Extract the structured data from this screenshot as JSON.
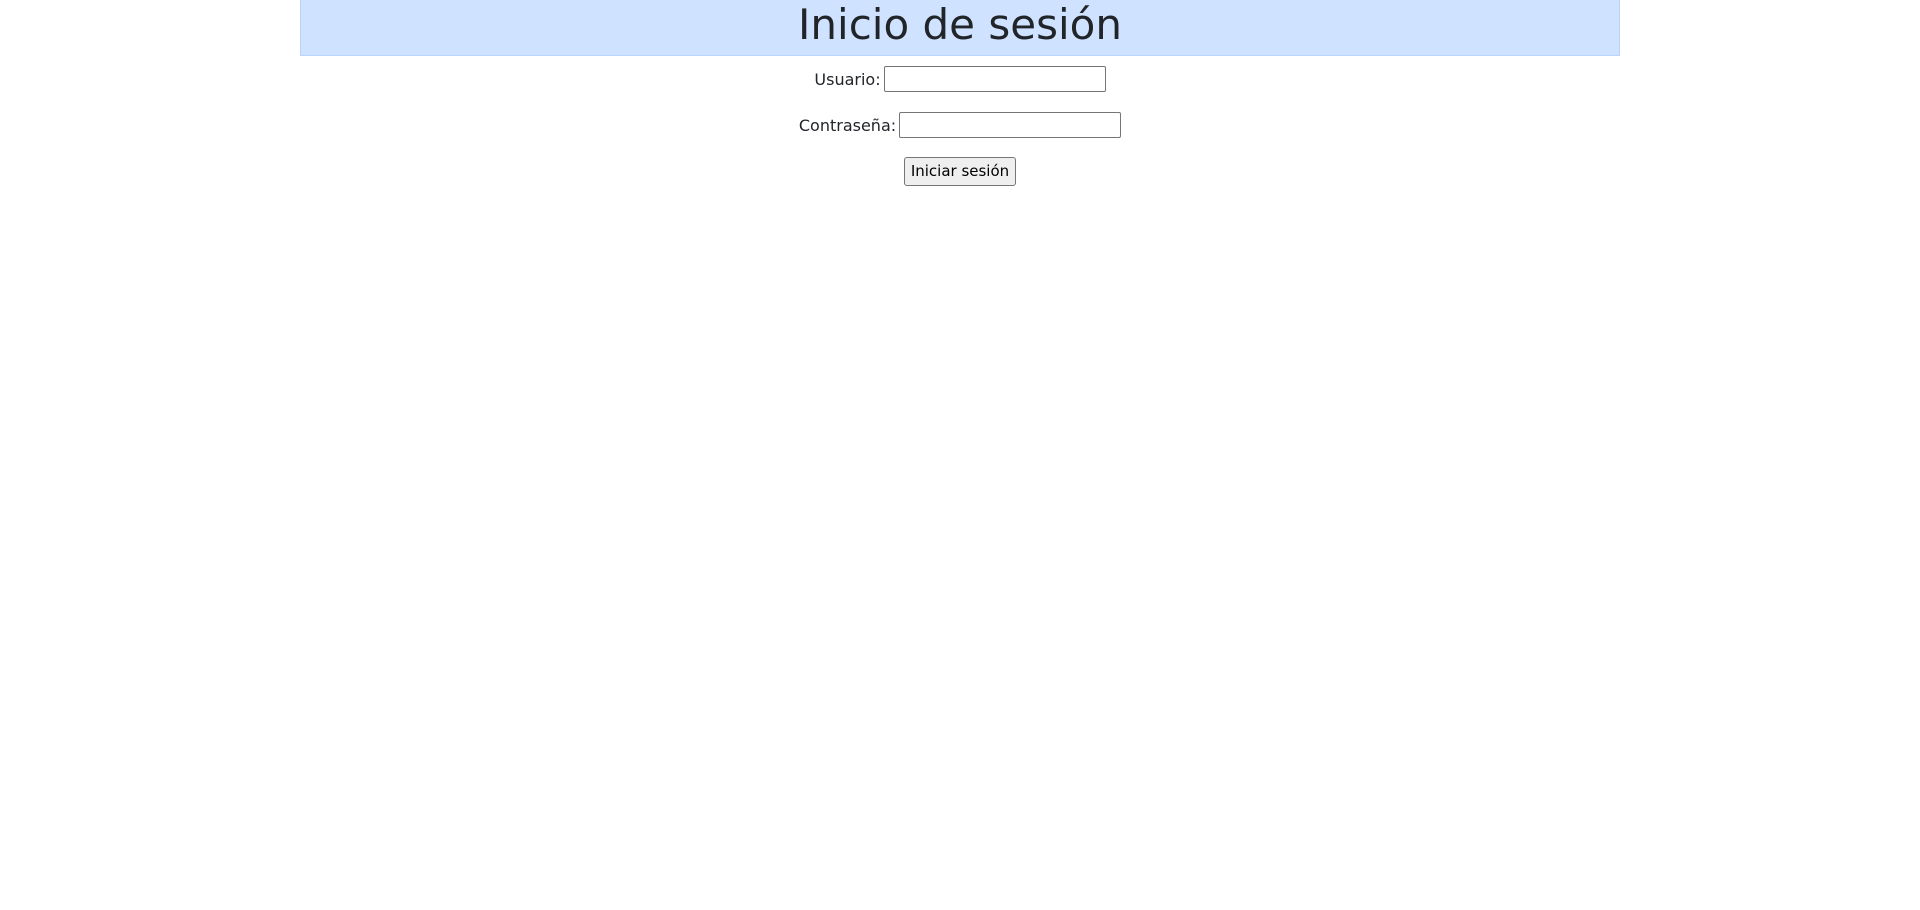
{
  "header": {
    "title": "Inicio de sesión"
  },
  "login_form": {
    "username_label": "Usuario:",
    "username_value": "",
    "password_label": "Contraseña:",
    "password_value": "",
    "submit_label": "Iniciar sesión"
  },
  "colors": {
    "header_background": "#cfe2ff",
    "text": "#212529"
  }
}
